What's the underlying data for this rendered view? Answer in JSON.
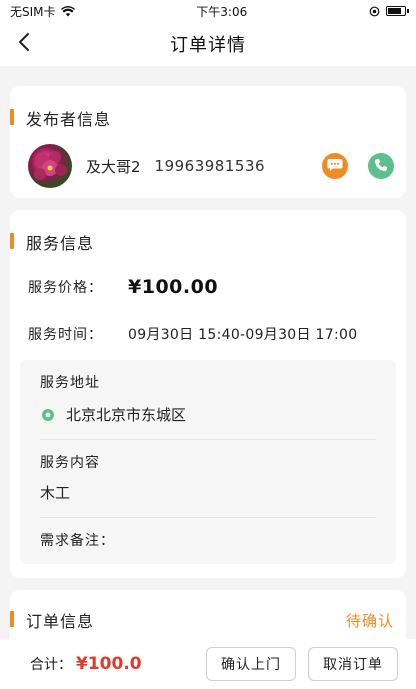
{
  "status_bar": {
    "carrier": "无SIM卡",
    "time": "下午3:06"
  },
  "nav": {
    "title": "订单详情"
  },
  "publisher": {
    "section_title": "发布者信息",
    "name": "及大哥2",
    "phone": "19963981536"
  },
  "service": {
    "section_title": "服务信息",
    "price_label": "服务价格：",
    "price_value": "¥100.00",
    "time_label": "服务时间：",
    "time_value": "09月30日 15:40-09月30日 17:00",
    "address_label": "服务地址",
    "address_value": "北京北京市东城区",
    "content_label": "服务内容",
    "content_value": "木工",
    "notes_label": "需求备注："
  },
  "order": {
    "section_title": "订单信息",
    "status": "待确认"
  },
  "bottom": {
    "total_label": "合计：",
    "total_value": "¥100.0",
    "confirm_label": "确认上门",
    "cancel_label": "取消订单"
  },
  "colors": {
    "accent": "#f08a24",
    "call": "#5cc08d",
    "price_red": "#e03a2e"
  },
  "icons": [
    "back-icon",
    "wifi-icon",
    "battery-icon",
    "chat-icon",
    "phone-icon",
    "location-pin-icon"
  ]
}
